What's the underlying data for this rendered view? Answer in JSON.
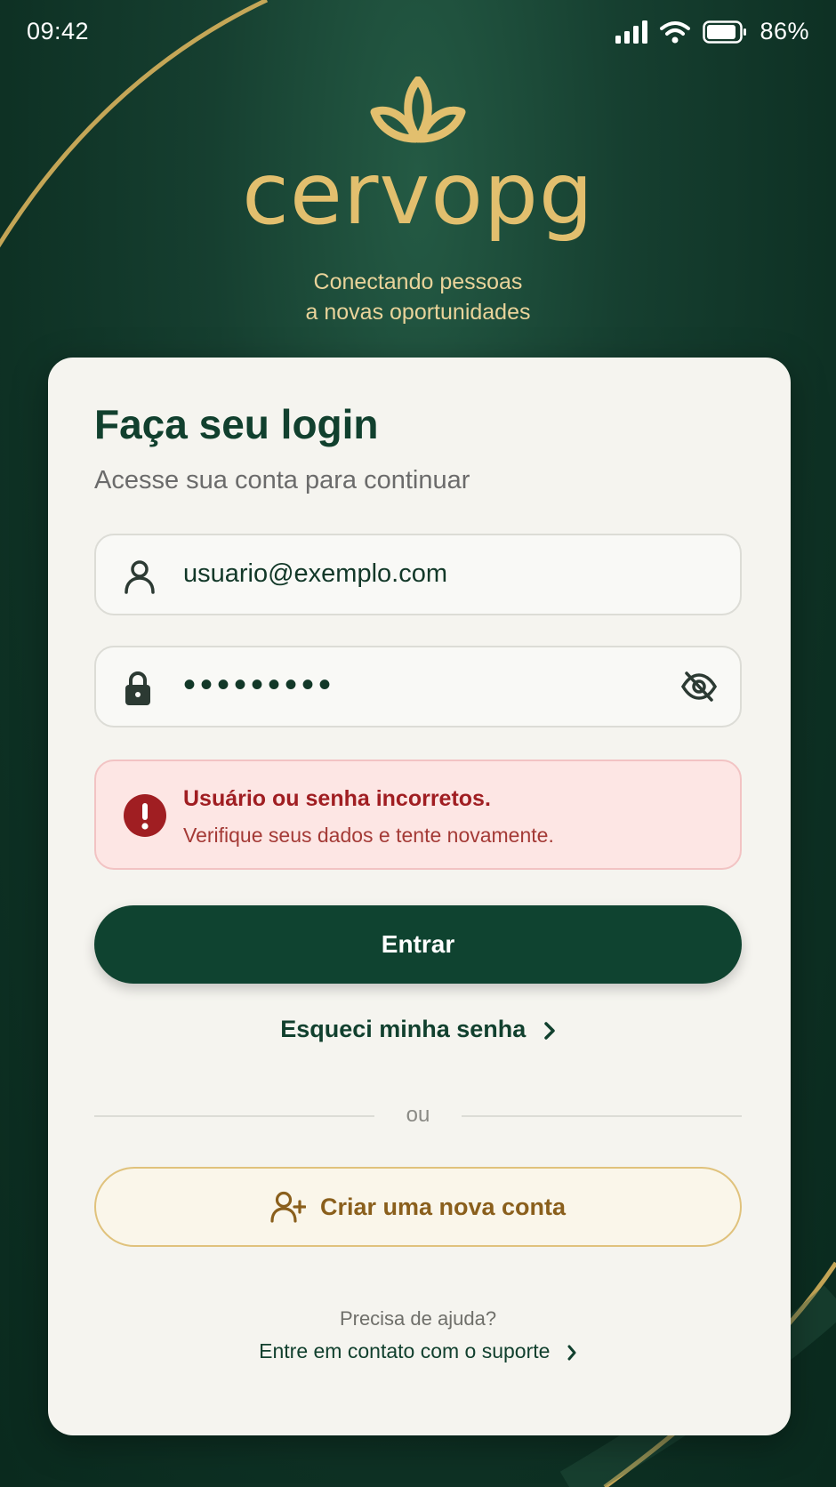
{
  "status_bar": {
    "time": "09:42",
    "battery_percent": "86%"
  },
  "brand": {
    "name": "cervopg",
    "tagline_line1": "Conectando pessoas",
    "tagline_line2": "a novas oportunidades"
  },
  "login": {
    "title": "Faça seu login",
    "subtitle": "Acesse sua conta para continuar",
    "username_value": "usuario@exemplo.com",
    "password_mask": "•••••••••",
    "error_title": "Usuário ou senha incorretos.",
    "error_message": "Verifique seus dados e tente novamente.",
    "submit_label": "Entrar",
    "forgot_label": "Esqueci minha senha",
    "divider_label": "ou",
    "create_account_label": "Criar uma nova conta",
    "help_label": "Precisa de ajuda?",
    "support_label": "Entre em contato com o suporte"
  },
  "colors": {
    "background": "#0e3124",
    "brand_gold": "#e2bf6e",
    "primary": "#0f4330",
    "error_bg": "#fde6e4",
    "error_text": "#a01e22"
  },
  "icons": [
    "signal-icon",
    "wifi-icon",
    "battery-icon",
    "lotus-logo-icon",
    "user-icon",
    "lock-icon",
    "eye-off-icon",
    "alert-icon",
    "chevron-right-icon",
    "user-plus-icon"
  ]
}
